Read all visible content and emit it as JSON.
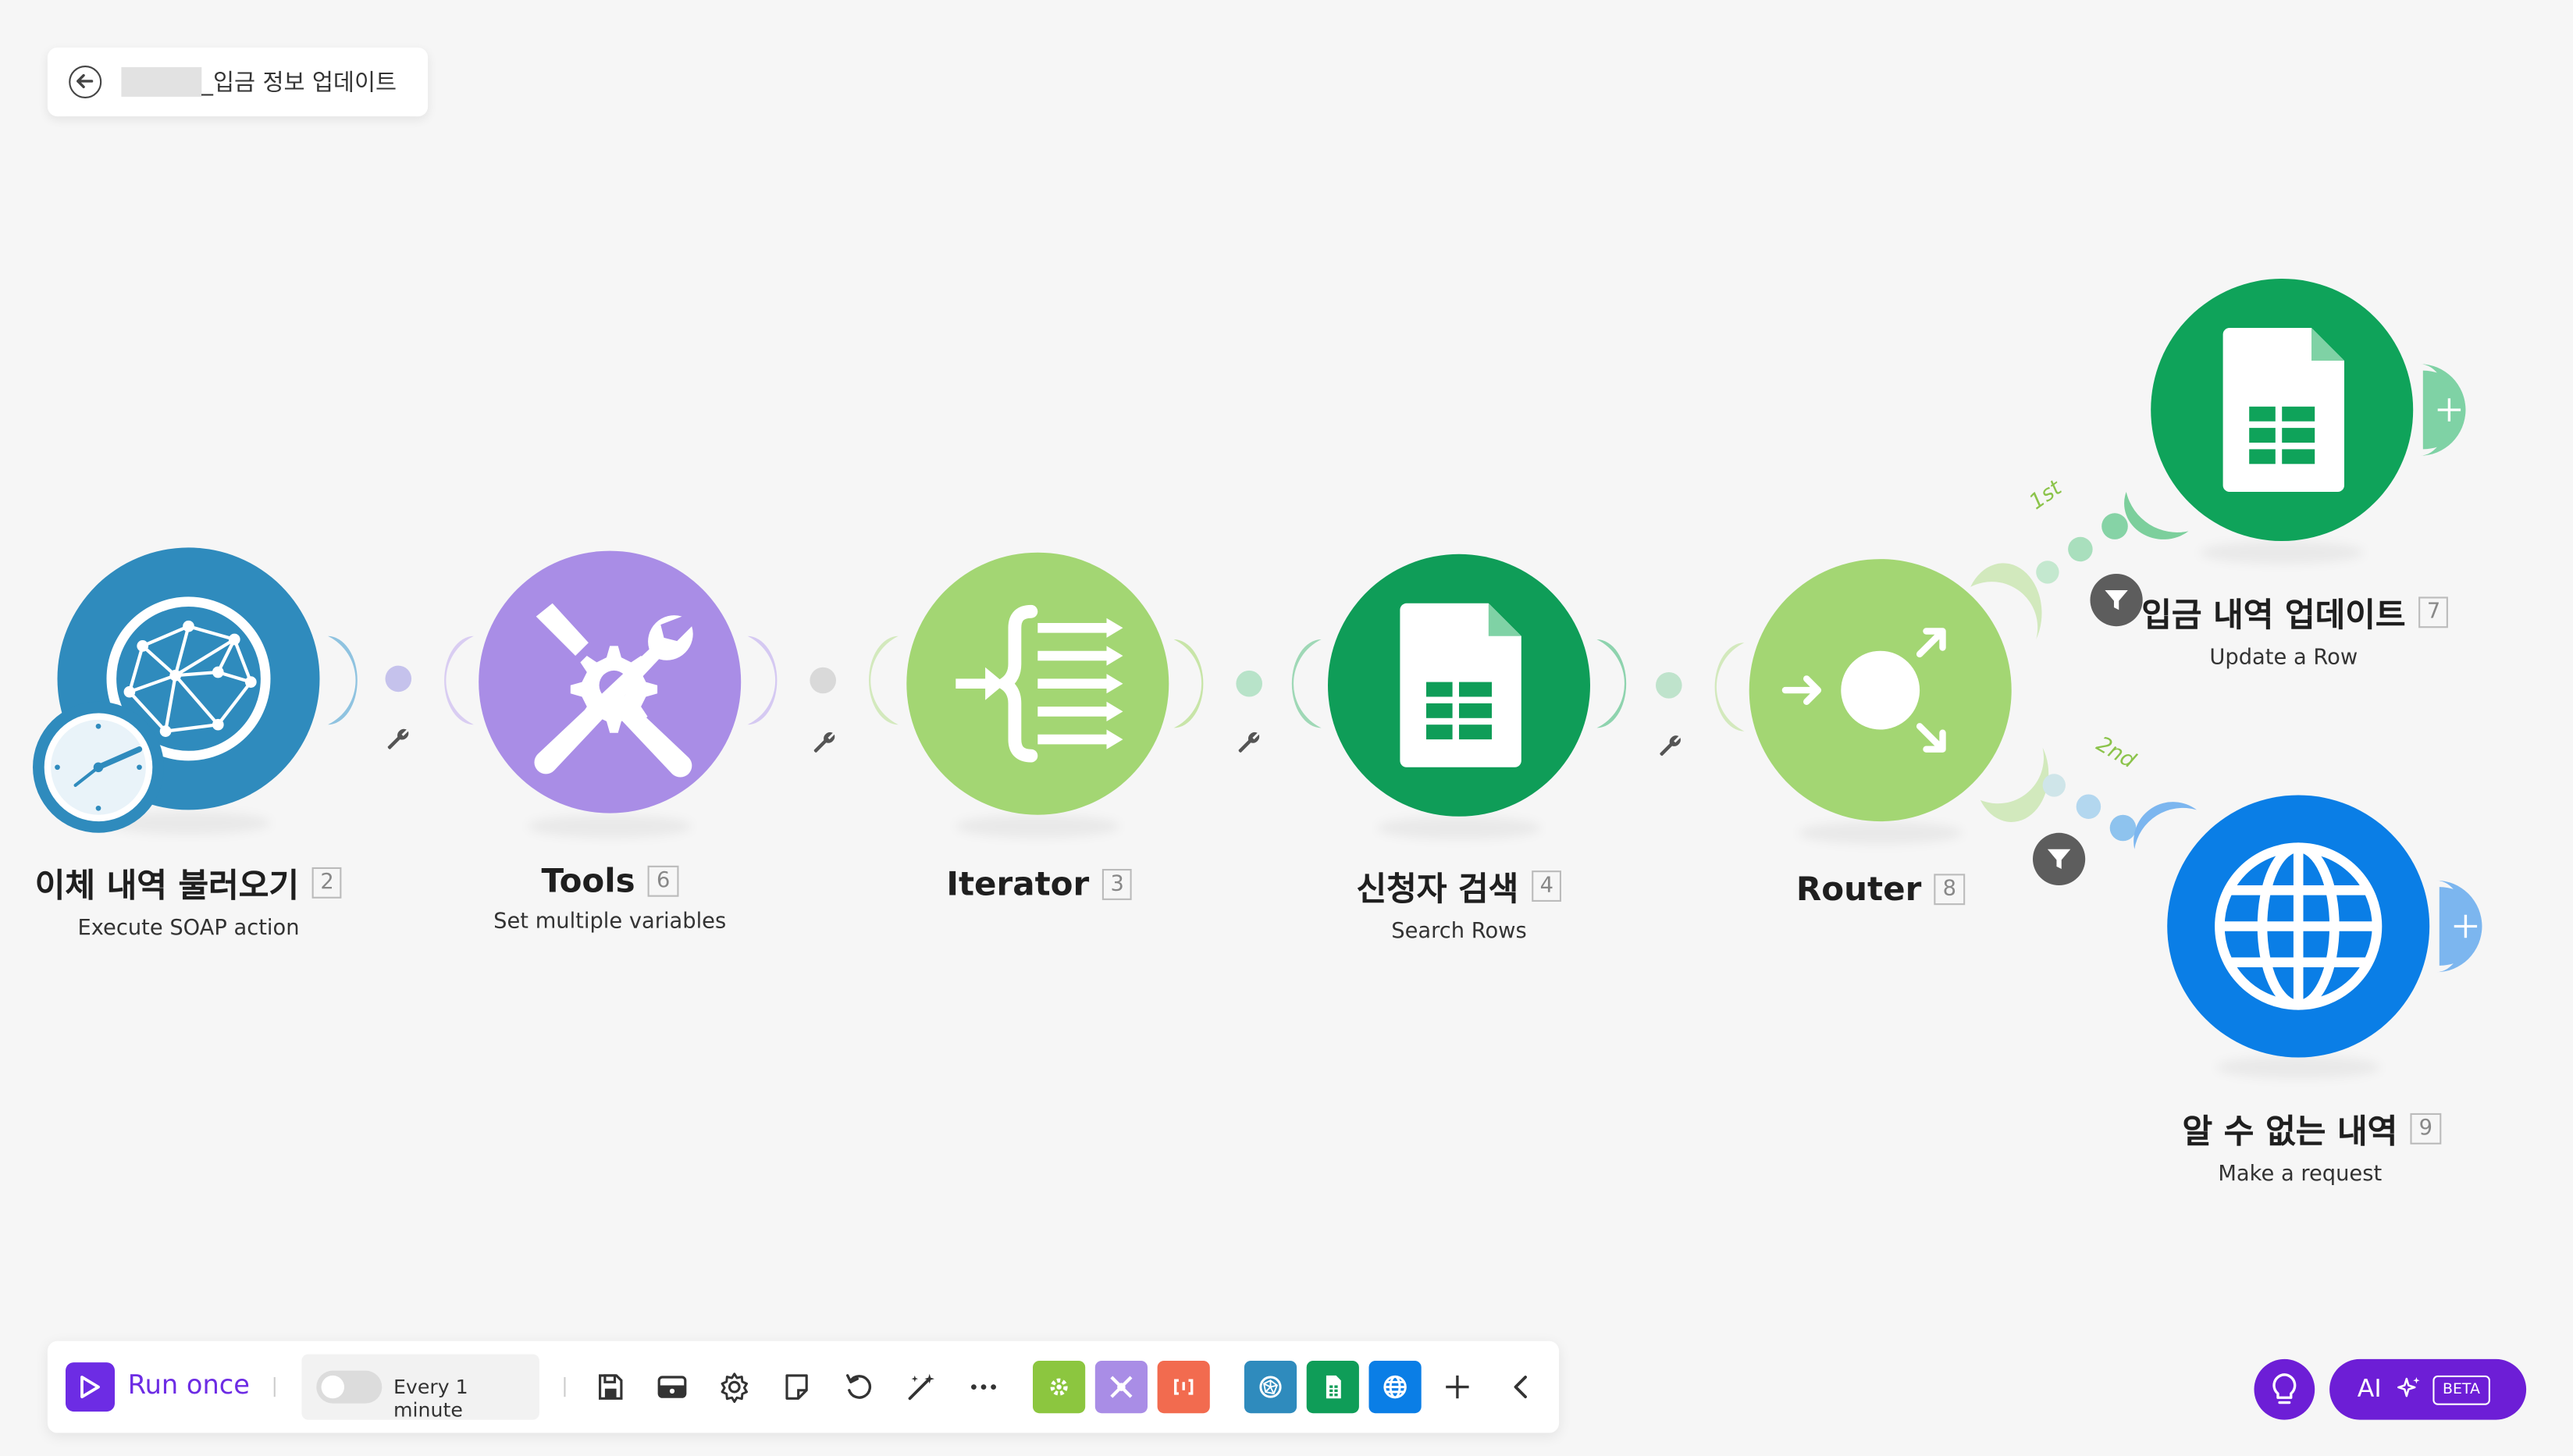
{
  "header": {
    "scenario_title": "_입금 정보 업데이트"
  },
  "modules": [
    {
      "name": "이체 내역 불러오기",
      "num": "2",
      "sub": "Execute SOAP action",
      "color": "#2f8bbd",
      "icon": "soap-globe-clock-icon"
    },
    {
      "name": "Tools",
      "num": "6",
      "sub": "Set multiple variables",
      "color": "#a98de6",
      "icon": "tools-icon"
    },
    {
      "name": "Iterator",
      "num": "3",
      "sub": "",
      "color": "#a3d673",
      "icon": "iterator-icon"
    },
    {
      "name": "신청자 검색",
      "num": "4",
      "sub": "Search Rows",
      "color": "#0f9d58",
      "icon": "google-sheets-icon"
    },
    {
      "name": "Router",
      "num": "8",
      "sub": "",
      "color": "#a3d673",
      "icon": "router-icon"
    },
    {
      "name": "입금 내역 업데이트",
      "num": "7",
      "sub": "Update a Row",
      "color": "#0fa35a",
      "icon": "google-sheets-icon"
    },
    {
      "name": "알 수 없는 내역",
      "num": "9",
      "sub": "Make a request",
      "color": "#0a7ee6",
      "icon": "http-globe-icon"
    }
  ],
  "routes": {
    "first": "1st",
    "second": "2nd"
  },
  "toolbar": {
    "run_label": "Run once",
    "schedule_label": "Every 1 minute",
    "icons": [
      "save-icon",
      "scenario-io-icon",
      "settings-icon",
      "notes-icon",
      "undo-icon",
      "auto-align-icon",
      "more-icon"
    ],
    "apps": [
      {
        "icon": "tools-app-icon",
        "color": "#8cc63f"
      },
      {
        "icon": "tools-app-icon",
        "color": "#a98de6"
      },
      {
        "icon": "json-app-icon",
        "color": "#f26b4f"
      },
      {
        "icon": "soap-app-icon",
        "color": "#2f8bbd"
      },
      {
        "icon": "google-sheets-app-icon",
        "color": "#0f9d58"
      },
      {
        "icon": "http-app-icon",
        "color": "#0a7ee6"
      }
    ]
  },
  "ai": {
    "label": "AI",
    "badge": "BETA"
  },
  "colors": {
    "accent": "#6d2ce4",
    "ai_purple": "#6d1ed6",
    "route_green": "#8bc34a"
  }
}
